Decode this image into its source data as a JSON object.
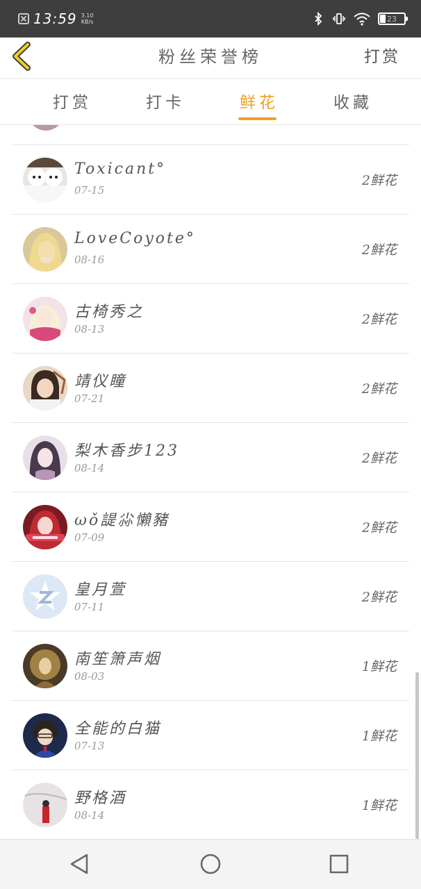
{
  "status_bar": {
    "time": "13:59",
    "net_speed_value": "3.10",
    "net_speed_unit": "KB/s",
    "battery": "23",
    "icons": [
      "notification-icon",
      "bluetooth-icon",
      "vibrate-icon",
      "wifi-icon",
      "battery-icon"
    ]
  },
  "header": {
    "title": "粉丝荣誉榜",
    "action": "打赏",
    "back_icon": "chevron-left-icon",
    "accent_color": "#f1a024"
  },
  "tabs": [
    {
      "label": "打赏",
      "active": false
    },
    {
      "label": "打卡",
      "active": false
    },
    {
      "label": "鲜花",
      "active": true
    },
    {
      "label": "收藏",
      "active": false
    }
  ],
  "fans": [
    {
      "name": "Toxicant°",
      "date": "07-15",
      "count": "2鲜花",
      "avatar": "twin-white-dogs"
    },
    {
      "name": "LoveCoyote°",
      "date": "08-16",
      "count": "2鲜花",
      "avatar": "blonde-anime-character"
    },
    {
      "name": "古椅秀之",
      "date": "08-13",
      "count": "2鲜花",
      "avatar": "pink-anime-girl"
    },
    {
      "name": "靖仪瞳",
      "date": "07-21",
      "count": "2鲜花",
      "avatar": "portrait-woman"
    },
    {
      "name": "梨木香步123",
      "date": "08-14",
      "count": "2鲜花",
      "avatar": "purple-anime-girl"
    },
    {
      "name": "ωǒ諟尛懶豬",
      "date": "07-09",
      "count": "2鲜花",
      "avatar": "red-hair-girl"
    },
    {
      "name": "皇月萱",
      "date": "07-11",
      "count": "2鲜花",
      "avatar": "qq-default-avatar"
    },
    {
      "name": "南笙箫声烟",
      "date": "08-03",
      "count": "1鲜花",
      "avatar": "golden-figure"
    },
    {
      "name": "全能的白猫",
      "date": "07-13",
      "count": "1鲜花",
      "avatar": "anime-boy-blue"
    },
    {
      "name": "野格酒",
      "date": "08-14",
      "count": "1鲜花",
      "avatar": "red-figure-snow"
    }
  ],
  "nav": [
    "back-triangle-icon",
    "home-circle-icon",
    "recents-square-icon"
  ]
}
